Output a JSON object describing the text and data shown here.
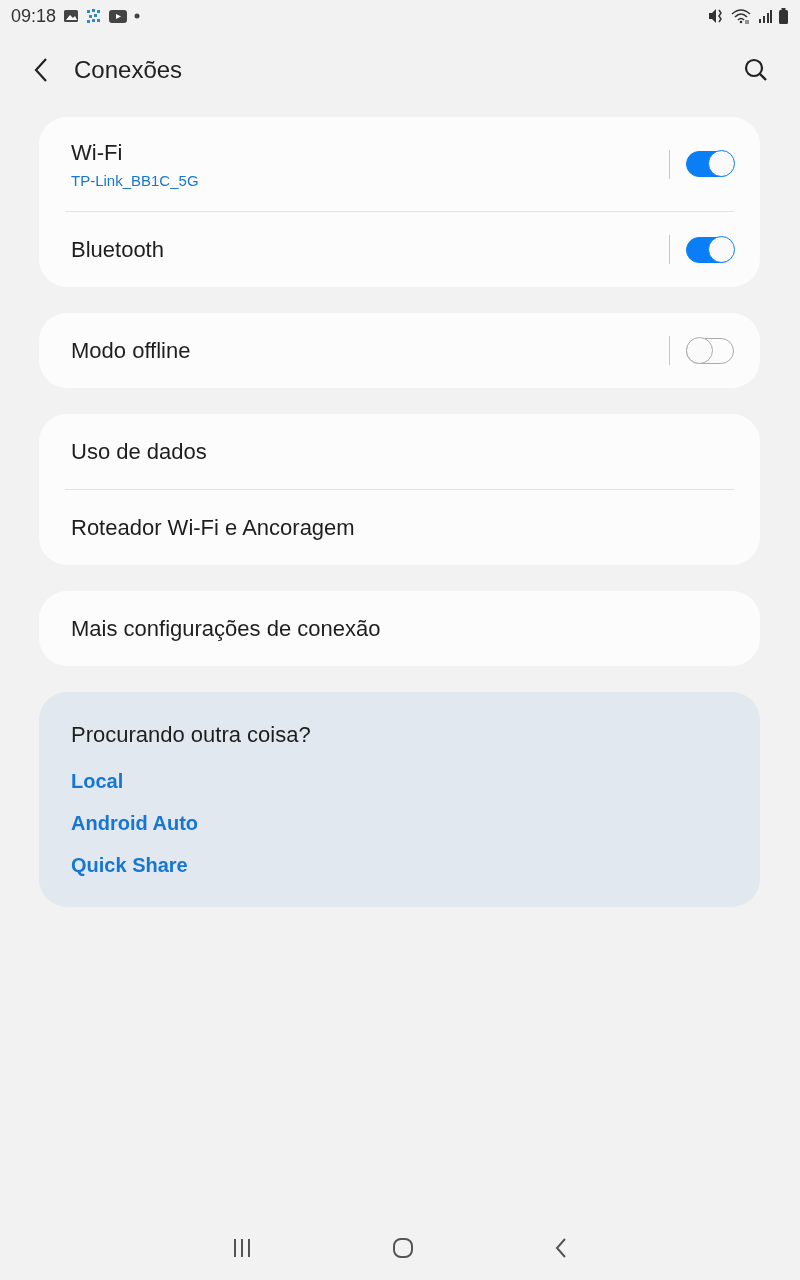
{
  "status_bar": {
    "time": "09:18"
  },
  "header": {
    "title": "Conexões"
  },
  "groups": [
    {
      "items": [
        {
          "kind": "toggle",
          "title": "Wi-Fi",
          "subtitle": "TP-Link_BB1C_5G",
          "on": true
        },
        {
          "kind": "toggle",
          "title": "Bluetooth",
          "on": true
        }
      ]
    },
    {
      "items": [
        {
          "kind": "toggle",
          "title": "Modo offline",
          "on": false
        }
      ]
    },
    {
      "items": [
        {
          "kind": "link",
          "title": "Uso de dados"
        },
        {
          "kind": "link",
          "title": "Roteador Wi-Fi e Ancoragem"
        }
      ]
    },
    {
      "items": [
        {
          "kind": "link",
          "title": "Mais configurações de conexão"
        }
      ]
    }
  ],
  "suggestions": {
    "title": "Procurando outra coisa?",
    "links": [
      "Local",
      "Android Auto",
      "Quick Share"
    ]
  }
}
